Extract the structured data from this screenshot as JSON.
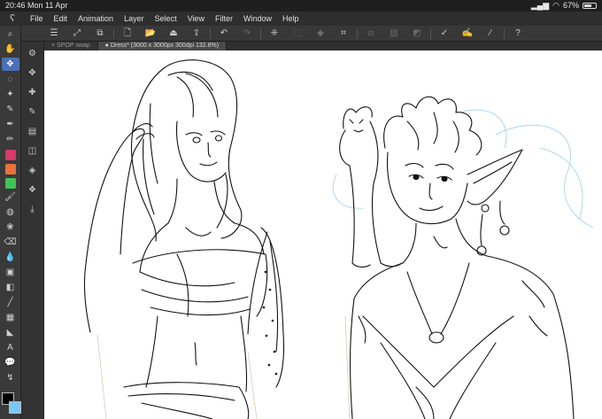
{
  "status": {
    "time": "20:46",
    "date": "Mon 11 Apr",
    "battery": "67%",
    "battery_level": 0.67
  },
  "menu": [
    "File",
    "Edit",
    "Animation",
    "Layer",
    "Select",
    "View",
    "Filter",
    "Window",
    "Help"
  ],
  "tabs": [
    {
      "label": "SPOP swap",
      "active": false
    },
    {
      "label": "Dress* (3000 x 3000px 300dpi 132.8%)",
      "active": true
    }
  ],
  "toolbar_icons": [
    "menu-icon",
    "transform-icon",
    "cut-icon",
    "new-canvas-icon",
    "open-icon",
    "save-icon",
    "export-icon",
    "undo-icon",
    "redo-icon",
    "clear-selection-icon",
    "select-all-icon",
    "fill-icon",
    "crop-icon",
    "ruler-off-icon",
    "snap-icon",
    "snap-grid-icon",
    "pen-pressure-icon",
    "brush-settings-icon",
    "stabilizer-icon",
    "help-icon"
  ],
  "tools": [
    {
      "name": "zoom",
      "glyph": "⌕"
    },
    {
      "name": "hand",
      "glyph": "✋"
    },
    {
      "name": "move-layer",
      "glyph": "✥",
      "selected": true
    },
    {
      "name": "lasso",
      "glyph": "◌"
    },
    {
      "name": "magic-wand",
      "glyph": "✦"
    },
    {
      "name": "eyedropper",
      "glyph": "✎"
    },
    {
      "name": "pen",
      "glyph": "✒"
    },
    {
      "name": "pencil",
      "glyph": "✏"
    },
    {
      "name": "brush",
      "glyph": "🖌"
    },
    {
      "name": "airbrush",
      "glyph": "◍"
    },
    {
      "name": "decoration",
      "glyph": "❀"
    },
    {
      "name": "eraser",
      "glyph": "⌫"
    },
    {
      "name": "blend",
      "glyph": "💧"
    },
    {
      "name": "fill",
      "glyph": "▣"
    },
    {
      "name": "gradient",
      "glyph": "◧"
    },
    {
      "name": "figure",
      "glyph": "╱"
    },
    {
      "name": "frame",
      "glyph": "▦"
    },
    {
      "name": "ruler",
      "glyph": "◣"
    },
    {
      "name": "text",
      "glyph": "A"
    },
    {
      "name": "balloon",
      "glyph": "💬"
    },
    {
      "name": "correct-line",
      "glyph": "↯"
    }
  ],
  "swatches": [
    "#d63a6a",
    "#e8743b",
    "#3fc457"
  ],
  "colors": {
    "main": "#000000",
    "sub": "#7ec7f2",
    "accent": "#4b6fb8"
  }
}
